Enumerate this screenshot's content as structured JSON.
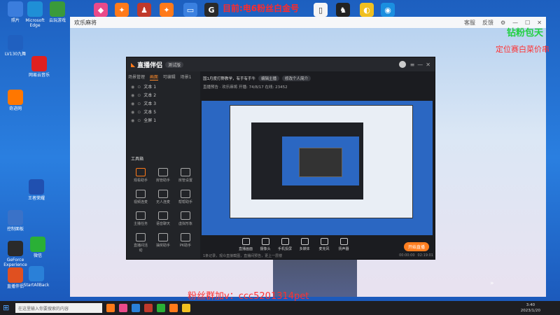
{
  "overlay": {
    "top_banner": "目前:电6粉丝白金号",
    "right_green": "钻粉包天",
    "right_red": "定位赛白菜价串",
    "bottom_red": "粉丝群加v：ccc5201314pet"
  },
  "desktop_icons": [
    {
      "label": "照片",
      "color": "#3b7ddd"
    },
    {
      "label": "Microsoft Edge",
      "color": "#1f8fd6"
    },
    {
      "label": "云玩游戏",
      "color": "#3a9a3a"
    },
    {
      "label": "LV130九舞",
      "color": "#2060c0"
    },
    {
      "label": "网易云音乐",
      "color": "#e02020"
    },
    {
      "label": "奇迹网",
      "color": "#ff7700"
    },
    {
      "label": "控制面板",
      "color": "#3a72c8"
    },
    {
      "label": "王者荣耀",
      "color": "#2050b0"
    },
    {
      "label": "GeForce Experience",
      "color": "#2a2a2a"
    },
    {
      "label": "微信",
      "color": "#2ab036"
    },
    {
      "label": "直播伴侣",
      "color": "#e05020"
    },
    {
      "label": "StartAllBack",
      "color": "#2a80d8"
    }
  ],
  "viewer": {
    "title": "欢乐麻将",
    "customer_service": "客服",
    "feedback": "反馈"
  },
  "app": {
    "name": "直播伴侣",
    "version": "测试版",
    "left_tabs": [
      "场景管理",
      "画面",
      "可编辑",
      "场景1"
    ],
    "scenes": [
      "文本 1",
      "文本 2",
      "文本 3",
      "文本 5",
      "全屏 1"
    ],
    "tools_title": "工具箱",
    "tools": [
      "观看助手",
      "房管助手",
      "房管设置",
      "视频连麦",
      "无人连麦",
      "帮帮助手",
      "主播任务",
      "语音聊天",
      "虚拟形象",
      "直播间活动",
      "抽奖助手",
      "PK助手"
    ],
    "header_text": "国1月度打野教学，有手有手牛",
    "header_pill1": "编辑主播",
    "header_pill2": "修改个人简介",
    "header_row2": "直播预告 · 欢乐麻将  开播: 74/8/17  在线: 23452",
    "bottom_buttons": [
      "直播画面",
      "摄像头",
      "手机投屏",
      "多媒体",
      "麦克风",
      "扬声器"
    ],
    "start_live": "开始直播",
    "status_text": "1条记录，观众直接截图，直播间预告，更上一层楼",
    "timer1": "00:00:00",
    "timer2": "02:19:01"
  },
  "taskbar": {
    "search_placeholder": "在这里输入你要搜索的内容",
    "time": "3:40",
    "date": "2023/1/20"
  }
}
